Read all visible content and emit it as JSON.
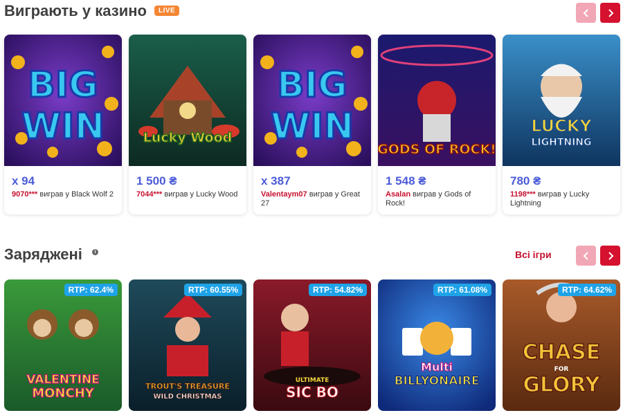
{
  "section1": {
    "title": "Виграють у казино",
    "badge": "LIVE",
    "cards": [
      {
        "amount": "x 94",
        "user": "9070***",
        "action": "виграв у",
        "game": "Black Wolf 2",
        "logo": [
          "BIG",
          "WIN"
        ]
      },
      {
        "amount": "1 500 ₴",
        "user": "7044***",
        "action": "виграв у",
        "game": "Lucky Wood",
        "logo": [
          "Lucky Wood"
        ]
      },
      {
        "amount": "x 387",
        "user": "Valentaym07",
        "action": "виграв у",
        "game": "Great 27",
        "logo": [
          "BIG",
          "WIN"
        ]
      },
      {
        "amount": "1 548 ₴",
        "user": "Asalan",
        "action": "виграв у",
        "game": "Gods of Rock!",
        "logo": [
          "GODS OF ROCK!"
        ]
      },
      {
        "amount": "780 ₴",
        "user": "1198***",
        "action": "виграв у",
        "game": "Lucky Lightning",
        "logo": [
          "LUCKY",
          "LIGHTNING"
        ]
      }
    ]
  },
  "section2": {
    "title": "Заряджені",
    "all_games": "Всі ігри",
    "cards": [
      {
        "rtp": "RTP: 62.4%",
        "logo": [
          "VALENTINE",
          "MONCHY"
        ]
      },
      {
        "rtp": "RTP: 60.55%",
        "logo": [
          "TROUT'S TREASURE",
          "WILD CHRISTMAS"
        ]
      },
      {
        "rtp": "RTP: 54.82%",
        "logo": [
          "ULTIMATE",
          "SIC BO"
        ]
      },
      {
        "rtp": "RTP: 61.08%",
        "logo": [
          "Multi",
          "BILLYONAIRE"
        ]
      },
      {
        "rtp": "RTP: 64.62%",
        "logo": [
          "CHASE",
          "FOR",
          "GLORY"
        ]
      }
    ]
  },
  "icons": {
    "prev": "chevron-left-icon",
    "next": "chevron-right-icon",
    "info": "info-icon"
  },
  "colors": {
    "accent": "#d5112f",
    "accent_light": "#f1a7b6",
    "amount": "#4b5bd8",
    "rtp_badge": "#1fa3e8",
    "live": "#f58634"
  }
}
